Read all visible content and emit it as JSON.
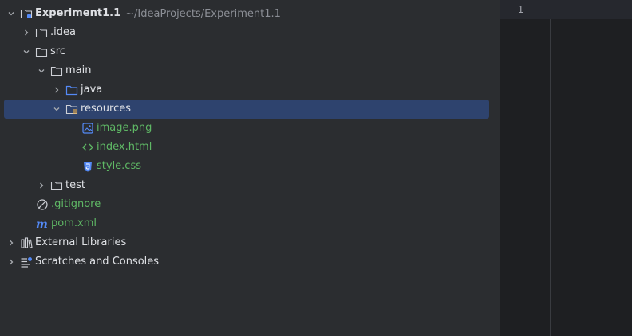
{
  "editor": {
    "line_numbers": [
      "1"
    ]
  },
  "tree": {
    "project": {
      "name": "Experiment1.1",
      "path": "~/IdeaProjects/Experiment1.1"
    },
    "idea": ".idea",
    "src": "src",
    "main": "main",
    "java": "java",
    "resources": "resources",
    "image": "image.png",
    "index": "index.html",
    "style": "style.css",
    "test": "test",
    "gitignore": ".gitignore",
    "pom": "pom.xml",
    "external_libraries": "External Libraries",
    "scratches": "Scratches and Consoles"
  },
  "colors": {
    "selection": "#2e436e",
    "vcs_added": "#5fb865",
    "folder_blue": "#548af7",
    "panel_bg": "#2b2d30",
    "editor_bg": "#1e1f22"
  }
}
